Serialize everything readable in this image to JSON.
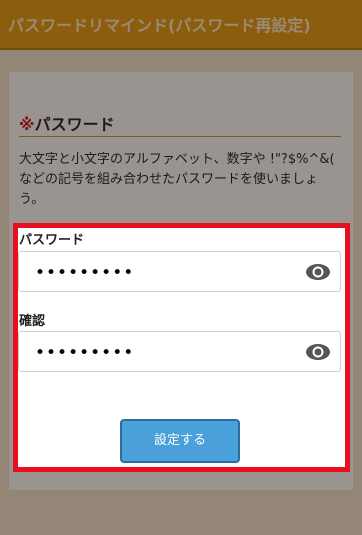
{
  "header": {
    "title": "パスワードリマインド(パスワード再設定)"
  },
  "section": {
    "mark": "※",
    "title": "パスワード",
    "description": "大文字と小文字のアルファベット、数字や !\"?$%^&( などの記号を組み合わせたパスワードを使いましょう。"
  },
  "password": {
    "label": "パスワード",
    "value": "•••••••••",
    "toggle_icon": "eye-icon"
  },
  "confirm": {
    "label": "確認",
    "value": "•••••••••",
    "toggle_icon": "eye-icon"
  },
  "submit": {
    "label": "設定する"
  },
  "colors": {
    "header_bg": "#8c5d0d",
    "highlight_border": "#e8101e",
    "button_bg": "#4aa0d8",
    "overlay_bg": "#948676"
  }
}
